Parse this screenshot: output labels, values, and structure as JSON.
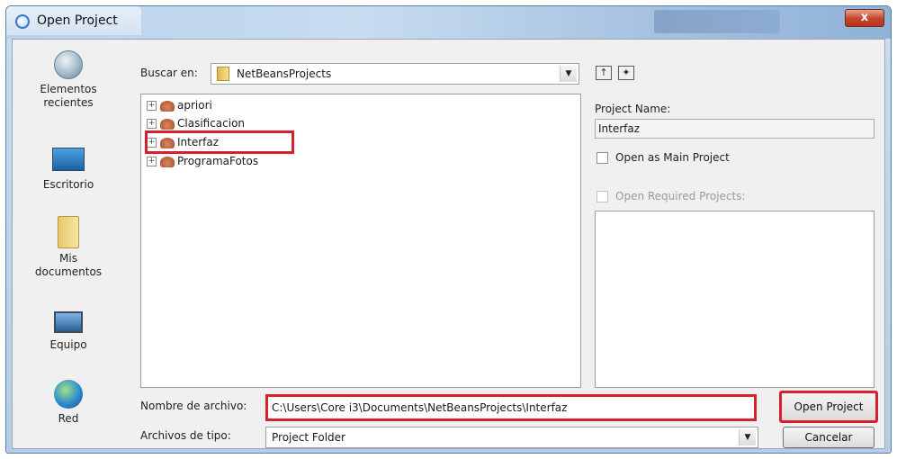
{
  "window": {
    "title": "Open Project",
    "close_symbol": "x"
  },
  "places": [
    {
      "label_line1": "Elementos",
      "label_line2": "recientes",
      "icon": "recent-items-icon"
    },
    {
      "label_line1": "Escritorio",
      "label_line2": "",
      "icon": "desktop-icon"
    },
    {
      "label_line1": "Mis",
      "label_line2": "documentos",
      "icon": "documents-icon"
    },
    {
      "label_line1": "Equipo",
      "label_line2": "",
      "icon": "computer-icon"
    },
    {
      "label_line1": "Red",
      "label_line2": "",
      "icon": "network-icon"
    }
  ],
  "lookin": {
    "label": "Buscar en:",
    "value": "NetBeansProjects",
    "arrow": "▼"
  },
  "toolbar": {
    "up_folder_icon": "up-folder-icon",
    "new_folder_icon": "new-folder-icon"
  },
  "file_list": {
    "items": [
      {
        "label": "apriori",
        "expander": "+"
      },
      {
        "label": "Clasificacion",
        "expander": "+"
      },
      {
        "label": "Interfaz",
        "expander": "+"
      },
      {
        "label": "ProgramaFotos",
        "expander": "+"
      }
    ]
  },
  "project_panel": {
    "name_label": "Project Name:",
    "name_value": "Interfaz",
    "main_project_label": "Open as Main Project",
    "required_label": "Open Required Projects:"
  },
  "filename": {
    "label": "Nombre de archivo:",
    "value": "C:\\Users\\Core i3\\Documents\\NetBeansProjects\\Interfaz"
  },
  "filetype": {
    "label": "Archivos de tipo:",
    "value": "Project Folder",
    "arrow": "▼"
  },
  "buttons": {
    "open_label": "Open Project",
    "cancel_label": "Cancelar"
  },
  "colors": {
    "highlight": "#d6202d",
    "titlebar": "#b9d2ec"
  }
}
